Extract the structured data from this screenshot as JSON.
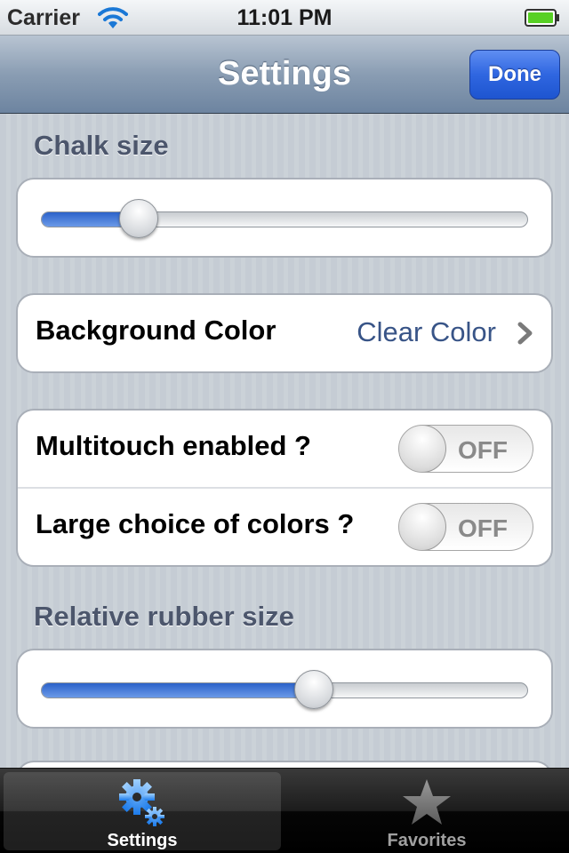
{
  "status_bar": {
    "carrier": "Carrier",
    "time": "11:01 PM",
    "wifi_icon": "wifi-icon",
    "battery_icon": "battery-icon",
    "battery_color": "#57d024"
  },
  "nav_bar": {
    "title": "Settings",
    "done_label": "Done"
  },
  "sections": {
    "chalk_size": {
      "label": "Chalk size",
      "value": 0.2
    },
    "background_color": {
      "label": "Background Color",
      "value": "Clear Color",
      "icon": "chevron-right-icon"
    },
    "multitouch": {
      "label": "Multitouch enabled ?",
      "state": "OFF"
    },
    "large_colors": {
      "label": "Large choice of colors ?",
      "state": "OFF"
    },
    "rubber_size": {
      "label": "Relative rubber size",
      "value": 0.56
    }
  },
  "tab_bar": {
    "tabs": [
      {
        "label": "Settings",
        "icon": "gears-icon",
        "selected": true
      },
      {
        "label": "Favorites",
        "icon": "star-icon",
        "selected": false
      }
    ]
  },
  "colors": {
    "accent": "#2f66e0",
    "value_text": "#385487",
    "section_label": "#4c566c"
  }
}
